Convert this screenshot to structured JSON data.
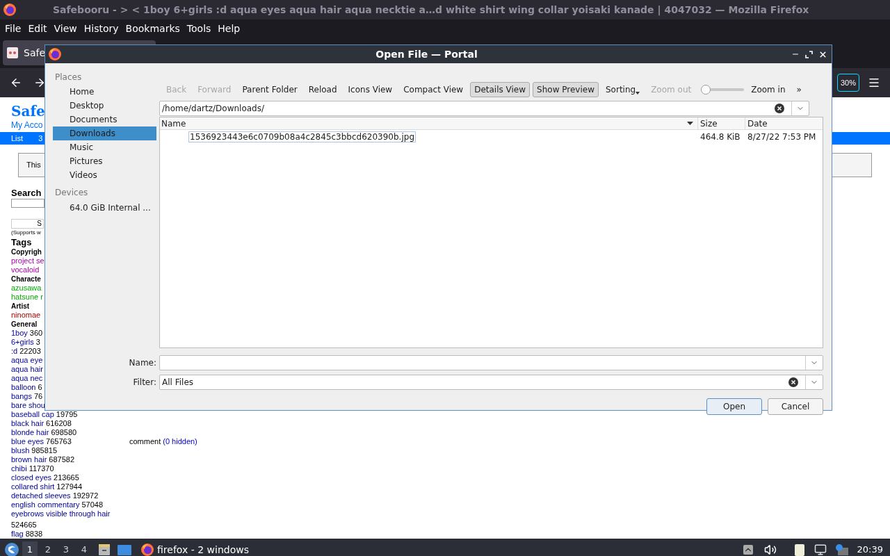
{
  "browser": {
    "title": "Safebooru - > < 1boy 6+girls :d aqua eyes aqua hair aqua necktie a…d white shirt wing collar yoisaki kanade | 4047032 — Mozilla Firefox",
    "menu": [
      "File",
      "Edit",
      "View",
      "History",
      "Bookmarks",
      "Tools",
      "Help"
    ],
    "tab": {
      "label": "Safe"
    },
    "zoom_badge": "30%"
  },
  "page": {
    "site_title": "Safe",
    "account_link": "My Acco",
    "nav": [
      "List",
      "3"
    ],
    "notice": "This",
    "search_heading": "Search",
    "search_button": "S",
    "search_hint": "(Supports w",
    "tags_heading": "Tags",
    "tag_groups": [
      {
        "title": "Copyrigh",
        "kind": "copyright",
        "tags": [
          {
            "tag": "project se"
          },
          {
            "tag": "vocaloid"
          }
        ]
      },
      {
        "title": "Characte",
        "kind": "character",
        "tags": [
          {
            "tag": "azusawa"
          },
          {
            "tag": "hatsune r"
          }
        ]
      },
      {
        "title": "Artist",
        "kind": "artist",
        "tags": [
          {
            "tag": "ninomae"
          }
        ]
      },
      {
        "title": "General",
        "kind": "general",
        "tags": [
          {
            "tag": "1boy",
            "count": "360"
          },
          {
            "tag": "6+girls",
            "count": "3"
          },
          {
            "tag": ":d",
            "count": "22203"
          },
          {
            "tag": "aqua eye"
          },
          {
            "tag": "aqua hair"
          },
          {
            "tag": "aqua nec"
          },
          {
            "tag": "balloon",
            "count": "6"
          },
          {
            "tag": "bangs",
            "count": "76"
          },
          {
            "tag": "bare shou"
          },
          {
            "tag": "baseball cap",
            "count": "19795"
          },
          {
            "tag": "black hair",
            "count": "616208"
          },
          {
            "tag": "blonde hair",
            "count": "698580"
          },
          {
            "tag": "blue eyes",
            "count": "765763"
          },
          {
            "tag": "blush",
            "count": "985815"
          },
          {
            "tag": "brown hair",
            "count": "687582"
          },
          {
            "tag": "chibi",
            "count": "117370"
          },
          {
            "tag": "closed eyes",
            "count": "213665"
          },
          {
            "tag": "collared shirt",
            "count": "127944"
          },
          {
            "tag": "detached sleeves",
            "count": "192972"
          },
          {
            "tag": "english commentary",
            "count": "57048"
          },
          {
            "tag": "eyebrows visible through hair",
            "count": "524665"
          },
          {
            "tag": "flag",
            "count": "8838"
          }
        ]
      }
    ],
    "comment_label": "comment",
    "comment_link": "(0 hidden)"
  },
  "dialog": {
    "title": "Open File — Portal",
    "places_heading": "Places",
    "places": [
      {
        "label": "Home",
        "selected": false
      },
      {
        "label": "Desktop",
        "selected": false
      },
      {
        "label": "Documents",
        "selected": false
      },
      {
        "label": "Downloads",
        "selected": true
      },
      {
        "label": "Music",
        "selected": false
      },
      {
        "label": "Pictures",
        "selected": false
      },
      {
        "label": "Videos",
        "selected": false
      }
    ],
    "devices_heading": "Devices",
    "devices": [
      {
        "label": "64.0 GiB Internal ...",
        "selected": false
      }
    ],
    "toolbar": [
      {
        "label": "Back",
        "kind": "action",
        "disabled": true,
        "checked": false
      },
      {
        "label": "Forward",
        "kind": "action",
        "disabled": true,
        "checked": false
      },
      {
        "label": "Parent Folder",
        "kind": "action",
        "disabled": false,
        "checked": false
      },
      {
        "label": "Reload",
        "kind": "action",
        "disabled": false,
        "checked": false
      },
      {
        "label": "Icons View",
        "kind": "action",
        "disabled": false,
        "checked": false
      },
      {
        "label": "Compact View",
        "kind": "action",
        "disabled": false,
        "checked": false
      },
      {
        "label": "Details View",
        "kind": "action",
        "disabled": false,
        "checked": true
      },
      {
        "label": "Show Preview",
        "kind": "action",
        "disabled": false,
        "checked": true
      },
      {
        "label": "Sorting",
        "kind": "menu",
        "disabled": false,
        "checked": false
      },
      {
        "label": "Zoom out",
        "kind": "action",
        "disabled": true,
        "checked": false
      },
      {
        "kind": "slider",
        "level": 0
      },
      {
        "label": "Zoom in",
        "kind": "action",
        "disabled": false,
        "checked": false
      },
      {
        "label": "»",
        "kind": "overflow"
      }
    ],
    "path": "/home/dartz/Downloads/",
    "columns": [
      "Name",
      "Size",
      "Date"
    ],
    "files": [
      {
        "name": "1536923443e6c0709b08a4c2845c3bbcd620390b.jpg",
        "size": "464.8 KiB",
        "date": "8/27/22 7:53 PM",
        "selected": false
      }
    ],
    "name_label": "Name:",
    "filter_label": "Filter:",
    "filter_value": "All Files",
    "buttons": [
      "Open",
      "Cancel"
    ]
  },
  "taskbar": {
    "workspaces": [
      {
        "label": "1",
        "selected": true
      },
      {
        "label": "2",
        "selected": false
      },
      {
        "label": "3",
        "selected": false
      },
      {
        "label": "4",
        "selected": false
      }
    ],
    "task": "firefox - 2 windows",
    "clock": "20:39"
  }
}
